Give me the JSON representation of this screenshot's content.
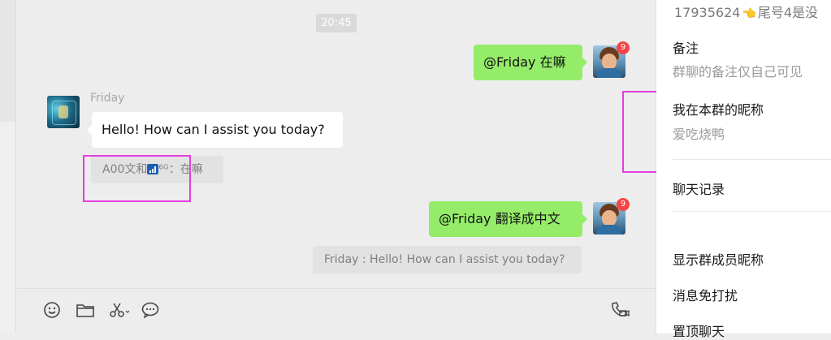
{
  "chat": {
    "timestamp": "20:45",
    "messages": [
      {
        "text": "@Friday 在嘛",
        "badge": "9"
      },
      {
        "sender": "Friday",
        "text": "Hello! How can I assist you today?",
        "quote_prefix": "A00文和",
        "quote_suffix": "⁶ᴳ：在嘛"
      },
      {
        "text": "@Friday 翻译成中文",
        "badge": "9",
        "quote": "Friday : Hello! How can I assist you today?"
      }
    ]
  },
  "toolbar": {
    "icons": [
      "emoji-icon",
      "folder-icon",
      "scissors-icon",
      "chat-bubble-icon",
      "video-call-icon"
    ]
  },
  "right_panel": {
    "id_line_prefix": "17935624",
    "id_line_suffix": "尾号4是没",
    "note_title": "备注",
    "note_sub": "群聊的备注仅自己可见",
    "nickname_title": "我在本群的昵称",
    "nickname_value": "爱吃烧鸭",
    "chat_history": "聊天记录",
    "show_nicknames": "显示群成员昵称",
    "mute": "消息免打扰",
    "pin": "置顶聊天"
  },
  "colors": {
    "own_bubble": "#95ec69",
    "other_bubble": "#ffffff",
    "highlight_box": "#e53ee0",
    "badge": "#f54545"
  }
}
